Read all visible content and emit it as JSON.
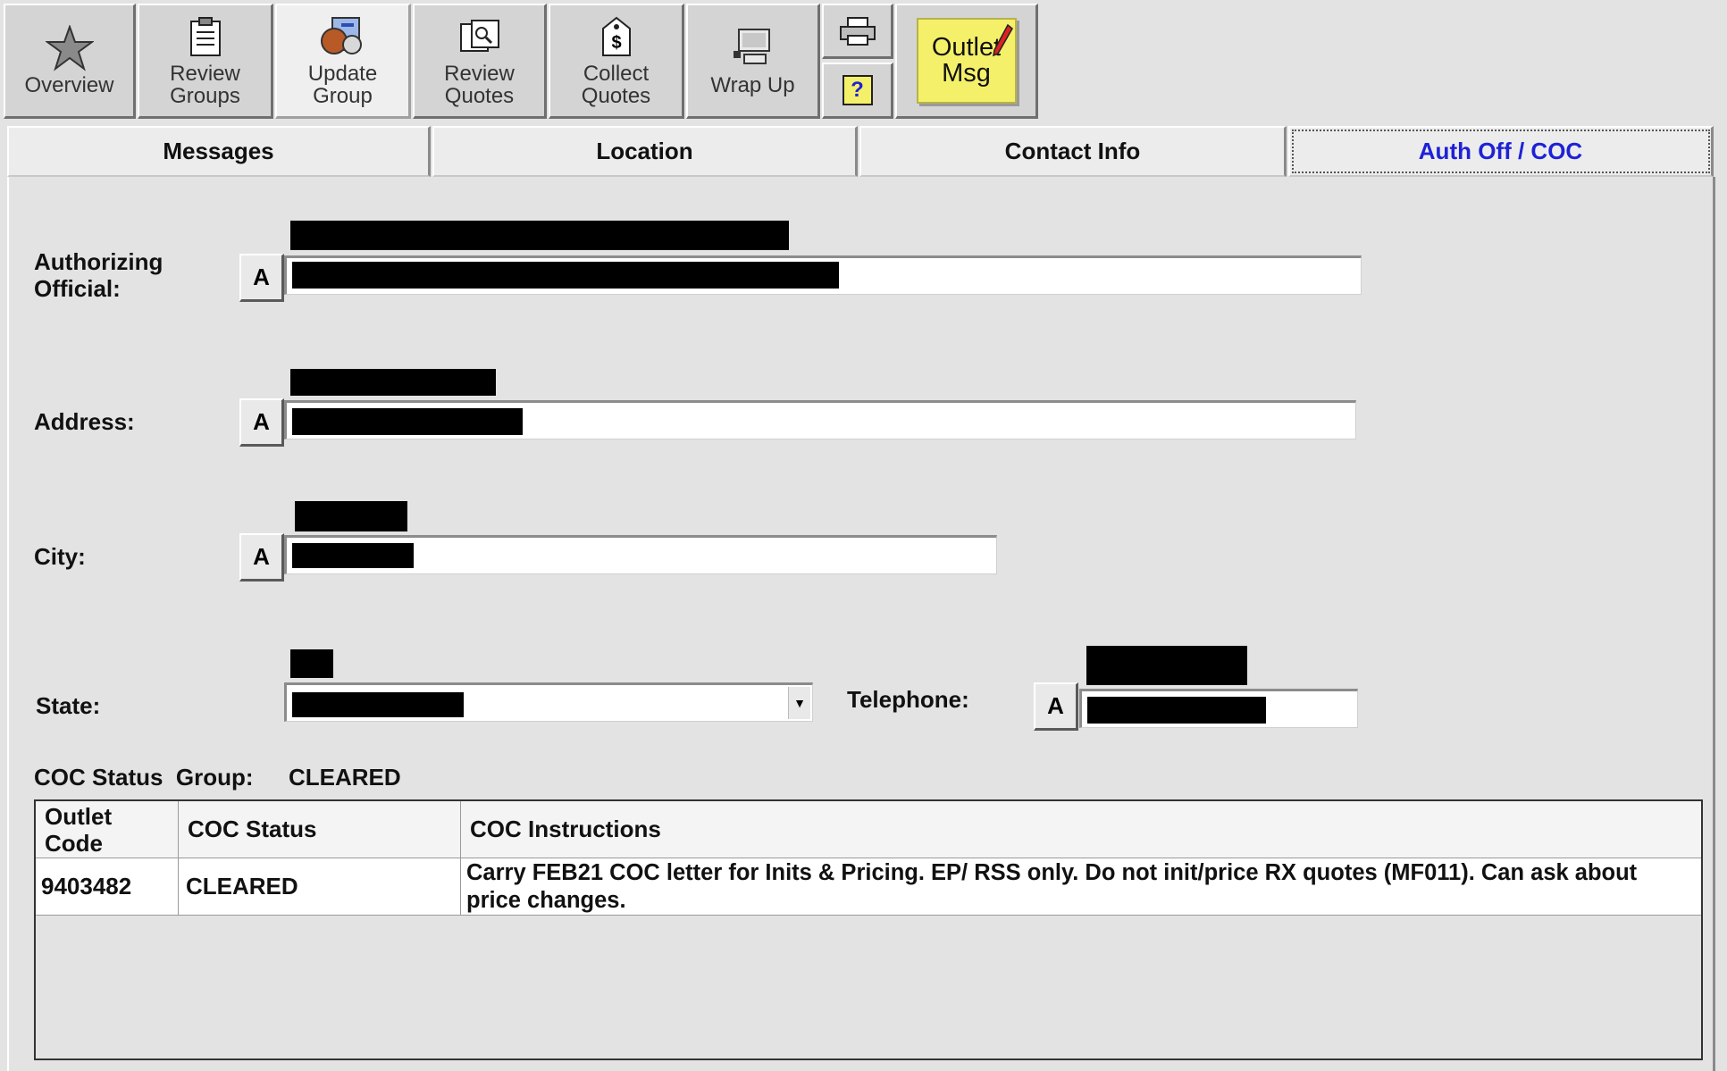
{
  "toolbar": {
    "buttons": [
      {
        "label": "Overview",
        "icon": "star-icon"
      },
      {
        "label": "Review Groups",
        "icon": "clipboard-icon"
      },
      {
        "label": "Update Group",
        "icon": "group-update-icon"
      },
      {
        "label": "Review Quotes",
        "icon": "quotes-list-icon"
      },
      {
        "label": "Collect Quotes",
        "icon": "price-tag-icon"
      },
      {
        "label": "Wrap Up",
        "icon": "computer-icon"
      }
    ],
    "outlet_msg": {
      "line1": "Outlet",
      "line2": "Msg",
      "icon": "pencil-icon"
    },
    "print_icon": "printer-icon",
    "help_icon": "help-icon"
  },
  "tabs": [
    {
      "label": "Messages"
    },
    {
      "label": "Location"
    },
    {
      "label": "Contact Info"
    },
    {
      "label": "Auth Off / COC",
      "active": true
    }
  ],
  "form": {
    "auth_label": "Authorizing Official:",
    "address_label": "Address:",
    "city_label": "City:",
    "state_label": "State:",
    "telephone_label": "Telephone:",
    "a_button": "A"
  },
  "coc": {
    "label": "COC Status  Group:",
    "value": "CLEARED",
    "columns": [
      "Outlet Code",
      "COC Status",
      "COC Instructions"
    ],
    "rows": [
      {
        "outlet_code": "9403482",
        "status": "CLEARED",
        "instructions": "Carry FEB21 COC letter for Inits & Pricing. EP/ RSS only. Do not init/price RX quotes (MF011). Can ask about price changes."
      }
    ]
  },
  "colors": {
    "active_tab": "#1e22d6",
    "note_yellow": "#f5f06a"
  }
}
